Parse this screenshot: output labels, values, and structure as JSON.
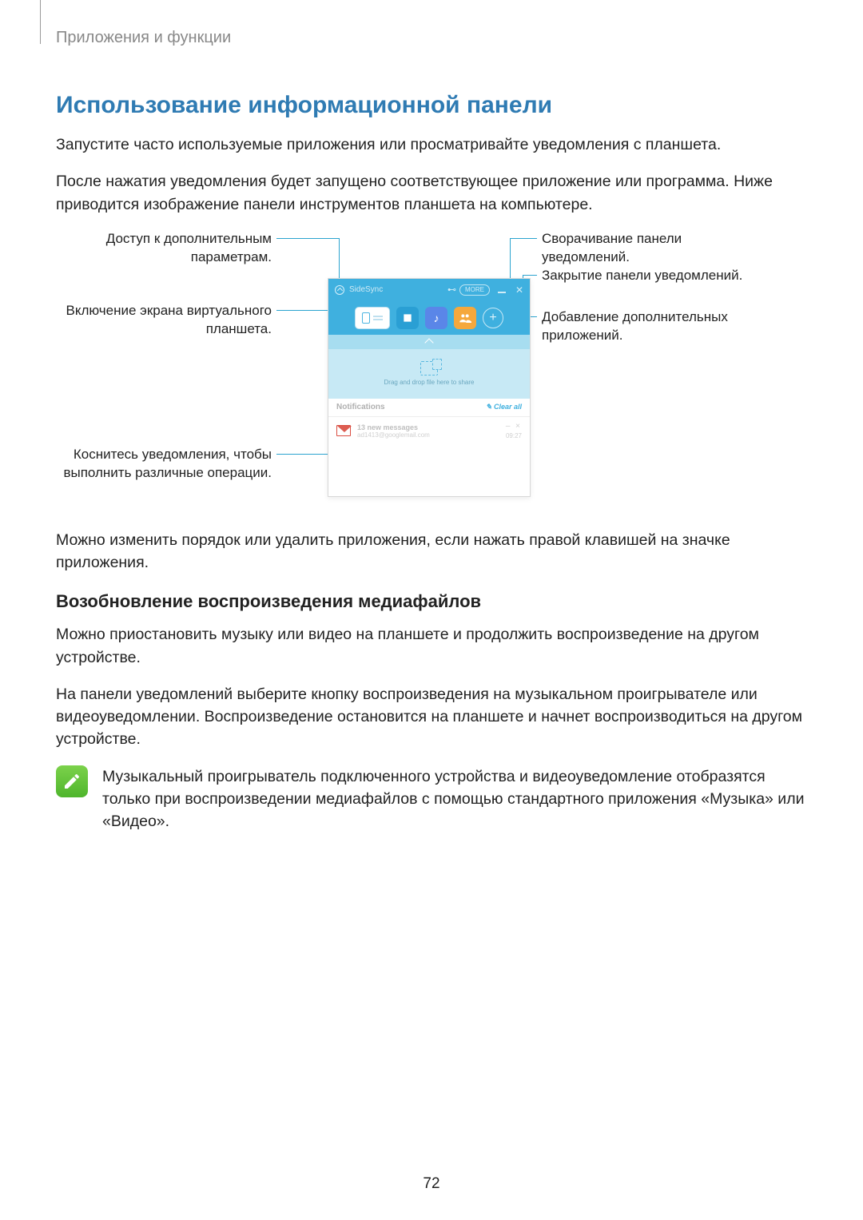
{
  "breadcrumb": "Приложения и функции",
  "heading1": "Использование информационной панели",
  "para1": "Запустите часто используемые приложения или просматривайте уведомления с планшета.",
  "para2": "После нажатия уведомления будет запущено соответствующее приложение или программа. Ниже приводится изображение панели инструментов планшета на компьютере.",
  "callouts": {
    "left1": "Доступ к дополнительным\nпараметрам.",
    "left2": "Включение экрана виртуального\nпланшета.",
    "left3": "Коснитесь уведомления, чтобы\nвыполнить различные операции.",
    "right1": "Сворачивание панели\nуведомлений.",
    "right2": "Закрытие панели уведомлений.",
    "right3": "Добавление дополнительных\nприложений."
  },
  "panel": {
    "title": "SideSync",
    "more": "MORE",
    "drop_hint": "Drag and drop file here to share",
    "notif_header": "Notifications",
    "clear_all": "Clear all",
    "notification": {
      "title": "13 new messages",
      "sub": "ad1413@googlemail.com",
      "actions": "– ×",
      "time": "09:27"
    }
  },
  "para3": "Можно изменить порядок или удалить приложения, если нажать правой клавишей на значке приложения.",
  "heading2": "Возобновление воспроизведения медиафайлов",
  "para4": "Можно приостановить музыку или видео на планшете и продолжить воспроизведение на другом устройстве.",
  "para5": "На панели уведомлений выберите кнопку воспроизведения на музыкальном проигрывателе или видеоуведомлении. Воспроизведение остановится на планшете и начнет воспроизводиться на другом устройстве.",
  "note": "Музыкальный проигрыватель подключенного устройства и видеоуведомление отобразятся только при воспроизведении медиафайлов с помощью стандартного приложения «Музыка» или «Видео».",
  "page_number": "72"
}
